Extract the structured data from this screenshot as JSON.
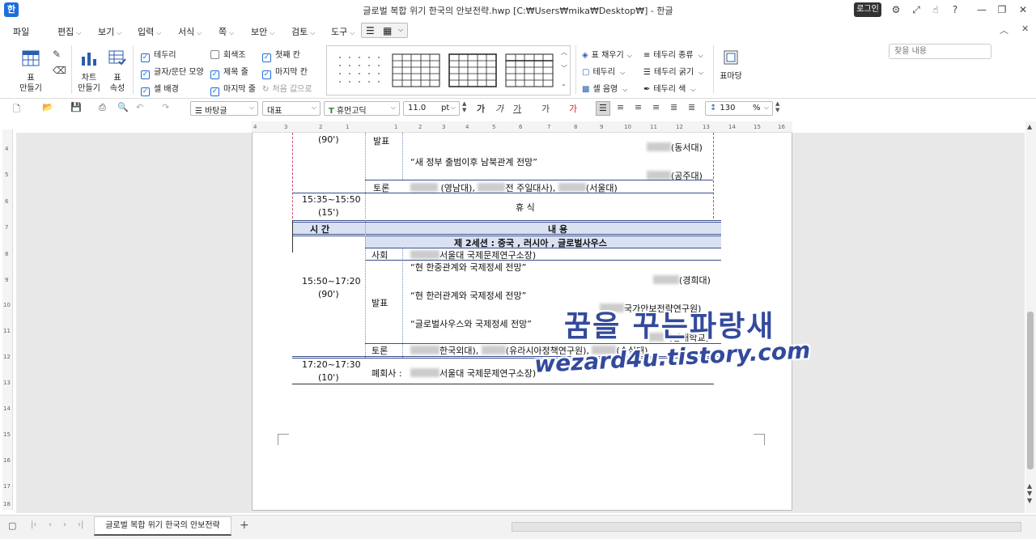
{
  "titlebar": {
    "title": "글로벌 복합 위기 한국의 안보전략.hwp [C:₩Users₩mika₩Desktop₩] - 한글",
    "app_icon": "한",
    "login": "로그인",
    "icons": [
      "gear-icon",
      "expand-icon",
      "hand-icon",
      "help-icon",
      "minimize-icon",
      "restore-icon",
      "close-icon"
    ]
  },
  "menu": {
    "items": [
      "파일",
      "편집",
      "보기",
      "입력",
      "서식",
      "쪽",
      "보안",
      "검토",
      "도구"
    ],
    "search_placeholder": "찾을 내용"
  },
  "ribbon": {
    "table_create": "표\n만들기",
    "chart_create": "차트\n만들기",
    "table_props": "표\n속성",
    "checks_col1": [
      {
        "label": "테두리",
        "checked": true
      },
      {
        "label": "글자/문단 모양",
        "checked": true
      },
      {
        "label": "셀 배경",
        "checked": true
      }
    ],
    "checks_col2": [
      {
        "label": "회색조",
        "checked": false
      },
      {
        "label": "제목 줄",
        "checked": true
      },
      {
        "label": "마지막 줄",
        "checked": true
      }
    ],
    "checks_col3": [
      {
        "label": "첫째 칸",
        "checked": true
      },
      {
        "label": "마지막 칸",
        "checked": true
      },
      {
        "label": "처음 값으로",
        "checked": false
      }
    ],
    "fill": "표 채우기",
    "border": "테두리",
    "cell_shade": "셀 음영",
    "border_type": "테두리 종류",
    "border_thick": "테두리 굵기",
    "border_color": "테두리 색",
    "table_margin": "표마당"
  },
  "toolbar": {
    "style": "바탕글",
    "outline": "대표",
    "font": "휴먼고딕",
    "size": "11.0",
    "unit": "pt",
    "line_spacing": "130",
    "ls_unit": "%"
  },
  "ruler": {
    "h": [
      "4",
      "3",
      "2",
      "1",
      "1",
      "2",
      "3",
      "4",
      "5",
      "6",
      "7",
      "8",
      "9",
      "10",
      "11",
      "12",
      "13",
      "14",
      "15",
      "16"
    ],
    "v": [
      "4",
      "5",
      "6",
      "7",
      "8",
      "9",
      "10",
      "11",
      "12",
      "13",
      "14",
      "15",
      "16",
      "17",
      "18"
    ]
  },
  "doc": {
    "row0": {
      "presenter1": "(동서대)",
      "speech": "“새 정부 출범이후 남북관계 전망”",
      "presenter2": "(공주대)"
    },
    "discussion1": {
      "label": "토론",
      "text_a": "(영남대),",
      "text_b": "전 주일대사),",
      "text_c": "(서울대)"
    },
    "break": {
      "time": "15:35~15:50",
      "dur": "(15')",
      "label": "휴  식"
    },
    "header": {
      "time_label": "시  간",
      "content_label": "내  용"
    },
    "session2": "제 2세션 : 중국 , 러시아 , 글로벌사우스",
    "chair": {
      "label": "사회",
      "text": "서울대 국제문제연구소장)"
    },
    "presentation": {
      "time": "15:50~17:20",
      "dur": "(90')",
      "label": "발표",
      "s1": "“현 한중관계와 국제정세 전망”",
      "a1": "(경희대)",
      "s2": "“현 한러관계와 국제정세 전망”",
      "a2": "국가안보전략연구원)",
      "s3": "“글로벌사우스와 국제정세 전망”",
      "a3": "국방대학교)"
    },
    "discussion2": {
      "label": "토론",
      "a": "한국외대),",
      "b": "(유라시아정책연구원),",
      "c": "(숭실대)"
    },
    "closing": {
      "time": "17:20~17:30",
      "dur": "(10')",
      "label": "폐회사 :",
      "text": "서울대 국제문제연구소장)"
    },
    "top_time": "(90')",
    "top_label": "발표"
  },
  "watermark": {
    "line1": "꿈을 꾸는파랑새",
    "line2": "wezard4u.tistory.com"
  },
  "status": {
    "tab": "글로벌 복합 위기 한국의 안보전략",
    "add": "+"
  }
}
